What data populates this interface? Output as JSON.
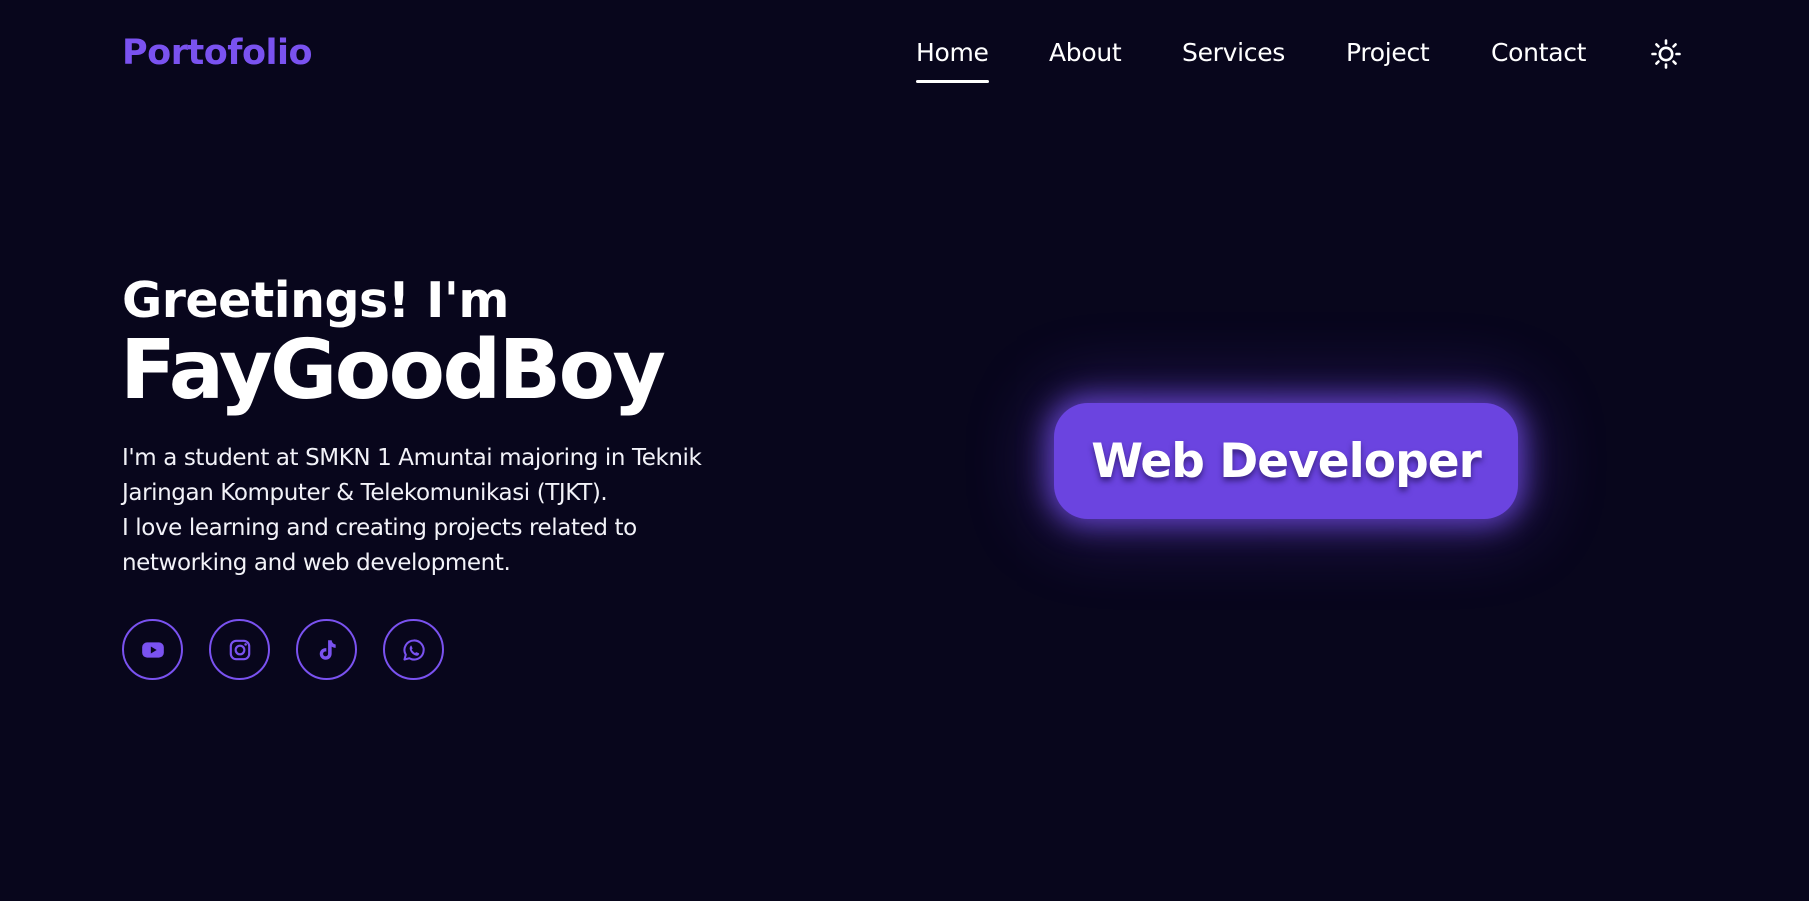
{
  "header": {
    "logo": "Portofolio",
    "nav": [
      {
        "label": "Home",
        "active": true
      },
      {
        "label": "About",
        "active": false
      },
      {
        "label": "Services",
        "active": false
      },
      {
        "label": "Project",
        "active": false
      },
      {
        "label": "Contact",
        "active": false
      }
    ],
    "theme_toggle_icon": "sun-icon"
  },
  "hero": {
    "greeting": "Greetings! I'm",
    "name": "FayGoodBoy",
    "bio_lines": [
      "I'm a student at SMKN 1 Amuntai majoring in Teknik",
      "Jaringan Komputer & Telekomunikasi (TJKT).",
      "I love learning and creating projects related to",
      "networking and web development."
    ],
    "role": "Web Developer"
  },
  "socials": [
    {
      "icon": "youtube-icon"
    },
    {
      "icon": "instagram-icon"
    },
    {
      "icon": "tiktok-icon"
    },
    {
      "icon": "whatsapp-icon"
    }
  ],
  "colors": {
    "background": "#08061c",
    "accent": "#7a52f0",
    "pill": "#6b44e0",
    "text": "#ffffff"
  }
}
